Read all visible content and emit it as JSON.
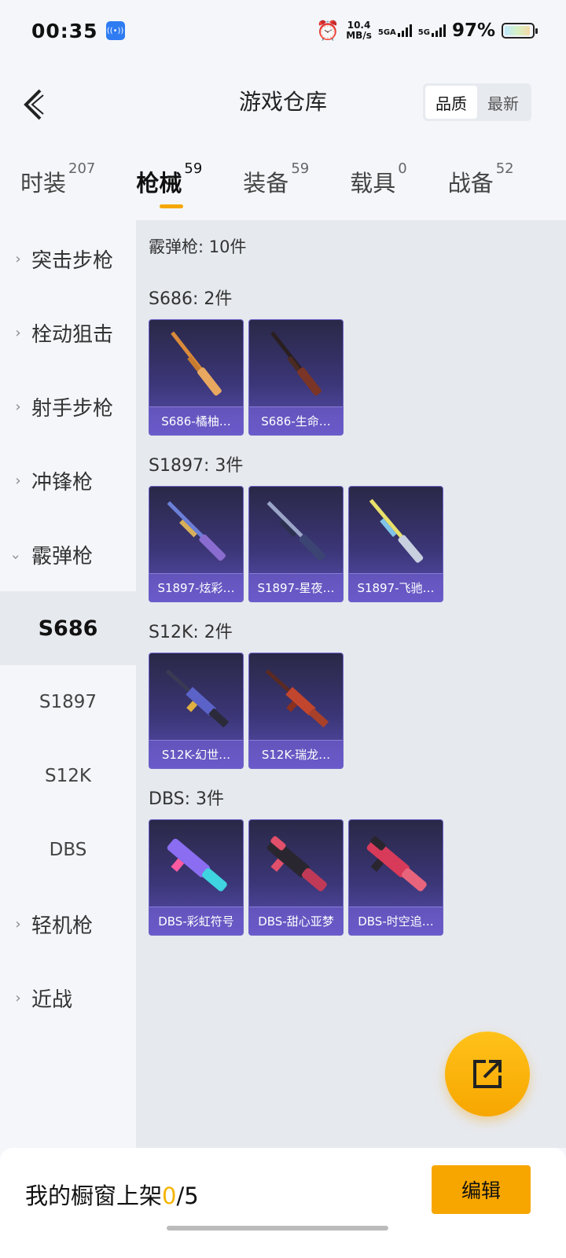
{
  "status_bar": {
    "time": "00:35",
    "nfc_badge": "((•))",
    "speed_value": "10.4",
    "speed_unit": "MB/s",
    "signal1": "5GA",
    "signal2": "5G",
    "battery": "97%"
  },
  "header": {
    "title": "游戏仓库",
    "sort_options": [
      "品质",
      "最新"
    ],
    "active_sort": "品质"
  },
  "tabs": [
    {
      "label": "时装",
      "count": "207"
    },
    {
      "label": "枪械",
      "count": "59"
    },
    {
      "label": "装备",
      "count": "59"
    },
    {
      "label": "载具",
      "count": "0"
    },
    {
      "label": "战备",
      "count": "52"
    }
  ],
  "active_tab": "枪械",
  "sidebar": {
    "categories": [
      "突击步枪",
      "栓动狙击",
      "射手步枪",
      "冲锋枪",
      "霰弹枪",
      "轻机枪",
      "近战"
    ],
    "sub_items": [
      "S686",
      "S1897",
      "S12K",
      "DBS"
    ],
    "active_sub": "S686"
  },
  "content": {
    "total": "霰弹枪: 10件",
    "groups": [
      {
        "title": "S686: 2件",
        "items": [
          "S686-橘柚…",
          "S686-生命…"
        ]
      },
      {
        "title": "S1897: 3件",
        "items": [
          "S1897-炫彩…",
          "S1897-星夜…",
          "S1897-飞驰…"
        ]
      },
      {
        "title": "S12K: 2件",
        "items": [
          "S12K-幻世…",
          "S12K-瑞龙…"
        ]
      },
      {
        "title": "DBS: 3件",
        "items": [
          "DBS-彩虹符号",
          "DBS-甜心亚梦",
          "DBS-时空追…"
        ]
      }
    ]
  },
  "bottom_bar": {
    "showcase_label": "我的橱窗上架",
    "showcase_count": "0",
    "showcase_total": "/5",
    "edit_label": "编辑"
  },
  "colors": {
    "accent": "#f7a600",
    "card_bg": "#3b3677"
  }
}
